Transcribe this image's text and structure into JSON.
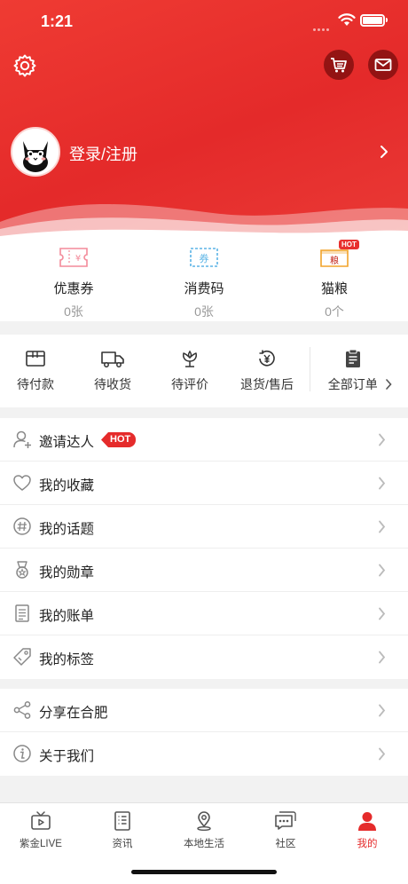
{
  "status_bar": {
    "time": "1:21"
  },
  "profile": {
    "login_label": "登录/注册"
  },
  "stats": [
    {
      "label": "优惠券",
      "value": "0张",
      "icon": "coupon-icon"
    },
    {
      "label": "消费码",
      "value": "0张",
      "icon": "voucher-icon"
    },
    {
      "label": "猫粮",
      "value": "0个",
      "icon": "cat-food-icon",
      "badge": "HOT",
      "badge_icon_text": "粮"
    }
  ],
  "stat_icon_text": {
    "coupon": "¥",
    "voucher": "券"
  },
  "orders": [
    {
      "label": "待付款",
      "icon": "wallet-icon"
    },
    {
      "label": "待收货",
      "icon": "truck-icon"
    },
    {
      "label": "待评价",
      "icon": "flower-icon"
    },
    {
      "label": "退货/售后",
      "icon": "refund-icon"
    },
    {
      "label": "全部订单",
      "icon": "clipboard-icon"
    }
  ],
  "menu_group1": [
    {
      "label": "邀请达人",
      "icon": "invite-user-icon",
      "badge": "HOT"
    },
    {
      "label": "我的收藏",
      "icon": "heart-icon"
    },
    {
      "label": "我的话题",
      "icon": "hashtag-icon"
    },
    {
      "label": "我的勋章",
      "icon": "medal-icon"
    },
    {
      "label": "我的账单",
      "icon": "bill-icon"
    },
    {
      "label": "我的标签",
      "icon": "tag-icon"
    }
  ],
  "menu_group2": [
    {
      "label": "分享在合肥",
      "icon": "share-icon"
    },
    {
      "label": "关于我们",
      "icon": "info-icon"
    }
  ],
  "tabs": [
    {
      "label": "紫金LIVE",
      "icon": "tv-icon"
    },
    {
      "label": "资讯",
      "icon": "news-icon"
    },
    {
      "label": "本地生活",
      "icon": "location-icon"
    },
    {
      "label": "社区",
      "icon": "chat-icon"
    },
    {
      "label": "我的",
      "icon": "user-icon",
      "active": true
    }
  ],
  "colors": {
    "brand_red": "#e52b2b",
    "header_red": "#ef3b33",
    "coupon_pink": "#f38a9a",
    "voucher_blue": "#5bb4e6",
    "catfood_orange": "#f2a32a"
  }
}
